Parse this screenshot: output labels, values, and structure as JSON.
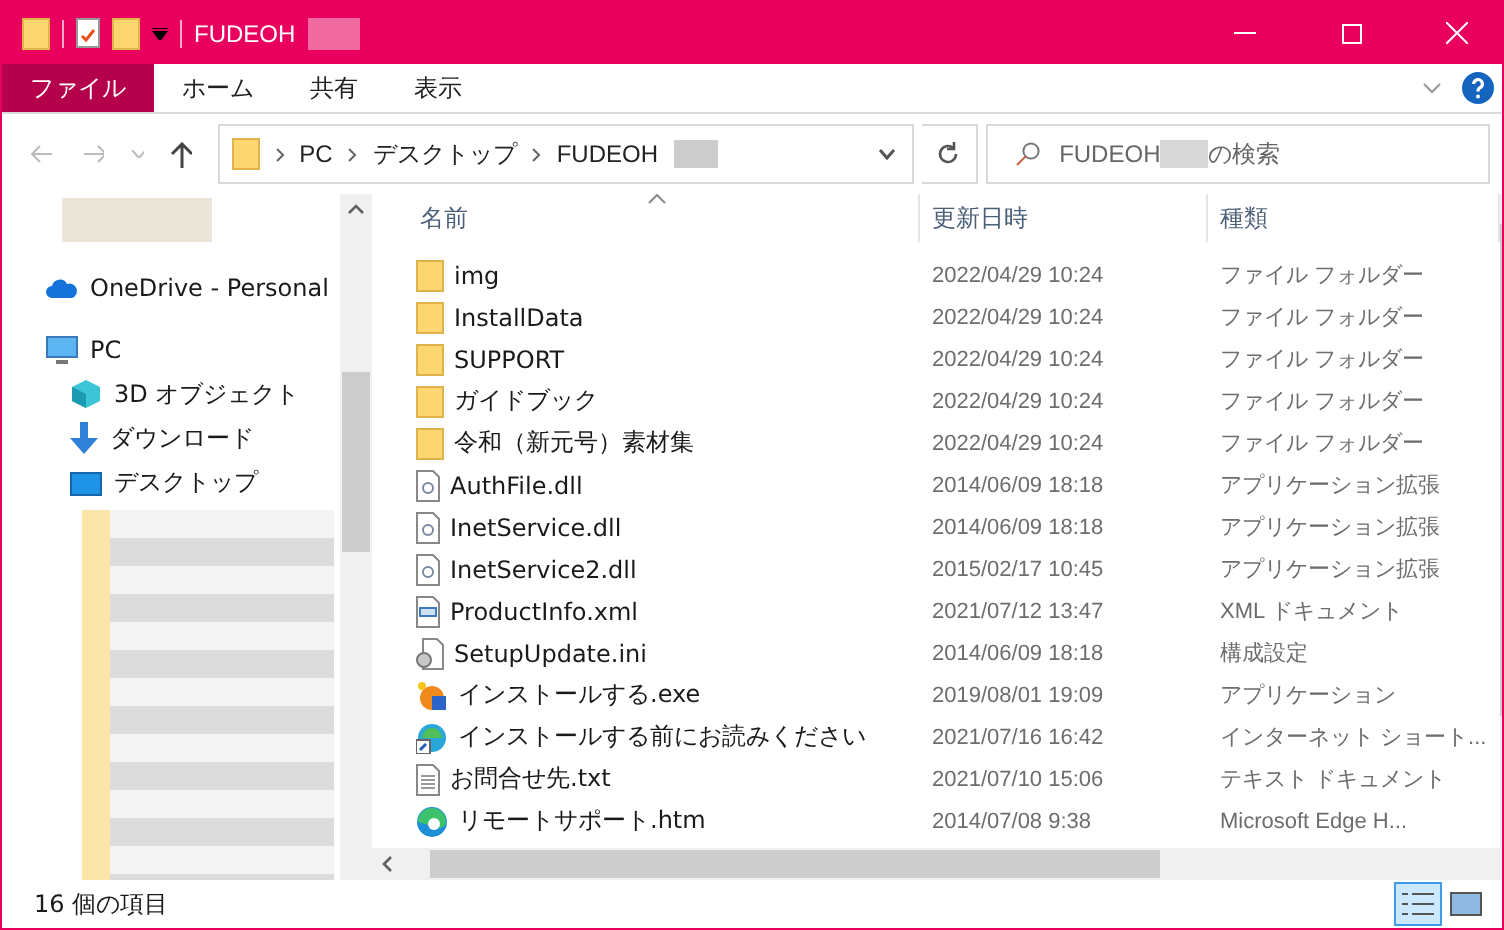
{
  "window": {
    "title": "FUDEOH"
  },
  "ribbon_tabs": [
    {
      "label": "ファイル",
      "selected": true
    },
    {
      "label": "ホーム",
      "selected": false
    },
    {
      "label": "共有",
      "selected": false
    },
    {
      "label": "表示",
      "selected": false
    }
  ],
  "address": {
    "crumbs": [
      "PC",
      "デスクトップ",
      "FUDEOH"
    ]
  },
  "search": {
    "placeholder_parts": [
      "FUDEOH",
      "の検索"
    ]
  },
  "nav": [
    {
      "kind": "onedrive",
      "label": "OneDrive - Personal"
    },
    {
      "kind": "pc",
      "label": "PC"
    },
    {
      "kind": "objects3d",
      "label": "3D オブジェクト"
    },
    {
      "kind": "download",
      "label": "ダウンロード"
    },
    {
      "kind": "desktop",
      "label": "デスクトップ"
    }
  ],
  "columns": [
    {
      "label": "名前",
      "sorted": true
    },
    {
      "label": "更新日時",
      "sorted": false
    },
    {
      "label": "種類",
      "sorted": false
    }
  ],
  "files": [
    {
      "kind": "folder",
      "name": "img",
      "date": "2022/04/29 10:24",
      "type": "ファイル フォルダー"
    },
    {
      "kind": "folder",
      "name": "InstallData",
      "date": "2022/04/29 10:24",
      "type": "ファイル フォルダー"
    },
    {
      "kind": "folder",
      "name": "SUPPORT",
      "date": "2022/04/29 10:24",
      "type": "ファイル フォルダー"
    },
    {
      "kind": "folder",
      "name": "ガイドブック",
      "date": "2022/04/29 10:24",
      "type": "ファイル フォルダー"
    },
    {
      "kind": "folder",
      "name": "令和（新元号）素材集",
      "date": "2022/04/29 10:24",
      "type": "ファイル フォルダー"
    },
    {
      "kind": "dll",
      "name": "AuthFile.dll",
      "date": "2014/06/09 18:18",
      "type": "アプリケーション拡張"
    },
    {
      "kind": "dll",
      "name": "InetService.dll",
      "date": "2014/06/09 18:18",
      "type": "アプリケーション拡張"
    },
    {
      "kind": "dll",
      "name": "InetService2.dll",
      "date": "2015/02/17 10:45",
      "type": "アプリケーション拡張"
    },
    {
      "kind": "xml",
      "name": "ProductInfo.xml",
      "date": "2021/07/12 13:47",
      "type": "XML ドキュメント"
    },
    {
      "kind": "ini",
      "name": "SetupUpdate.ini",
      "date": "2014/06/09 18:18",
      "type": "構成設定"
    },
    {
      "kind": "exe",
      "name": "インストールする.exe",
      "date": "2019/08/01 19:09",
      "type": "アプリケーション"
    },
    {
      "kind": "shortcut",
      "name": "インストールする前にお読みください",
      "date": "2021/07/16 16:42",
      "type": "インターネット ショート..."
    },
    {
      "kind": "txt",
      "name": "お問合せ先.txt",
      "date": "2021/07/10 15:06",
      "type": "テキスト ドキュメント"
    },
    {
      "kind": "edge",
      "name": "リモートサポート.htm",
      "date": "2014/07/08 9:38",
      "type": "Microsoft Edge H..."
    }
  ],
  "status_bar": {
    "count": "16 個の項目"
  },
  "views": [
    {
      "kind": "details",
      "selected": true
    },
    {
      "kind": "large",
      "selected": false
    }
  ]
}
